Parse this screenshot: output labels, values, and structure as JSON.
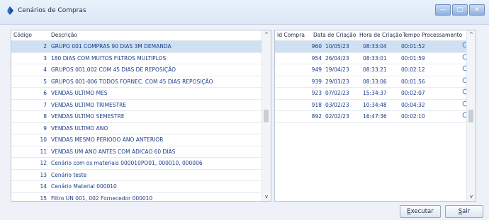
{
  "window": {
    "title": "Cenários de Compras",
    "minimize_glyph": "—",
    "maximize_glyph": "□",
    "close_glyph": "✕"
  },
  "left_table": {
    "headers": {
      "code": "Código",
      "desc": "Descrição"
    },
    "rows": [
      {
        "code": "2",
        "desc": "GRUPO 001 COMPRAS 90 DIAS 3M DEMANDA",
        "selected": true
      },
      {
        "code": "3",
        "desc": "180 DIAS COM MUITOS FILTROS MULTIPLOS"
      },
      {
        "code": "4",
        "desc": "GRUPOS 001,002 COM 45 DIAS DE REPOSIÇÃO"
      },
      {
        "code": "5",
        "desc": "GRUPOS 001-006 TODOS FORNEC. COM 45 DIAS REPOSIÇÃO"
      },
      {
        "code": "6",
        "desc": "VENDAS ULTIMO MES"
      },
      {
        "code": "7",
        "desc": "VENDAS ULTIMO TRIMESTRE"
      },
      {
        "code": "8",
        "desc": "VENDAS ULTIMO SEMESTRE"
      },
      {
        "code": "9",
        "desc": "VENDAS ULTIMO ANO"
      },
      {
        "code": "10",
        "desc": "VENDAS MESMO PERIODO ANO ANTERIOR"
      },
      {
        "code": "11",
        "desc": "VENDAS UM ANO ANTES COM ADICAO 60 DIAS"
      },
      {
        "code": "12",
        "desc": "Cenário com os materiais 000010PO01, 000010, 000006"
      },
      {
        "code": "13",
        "desc": "Cenário teste"
      },
      {
        "code": "14",
        "desc": "Cenário Material 000010"
      },
      {
        "code": "15",
        "desc": "Filtro UN 001, 002 Fornecedor 000010"
      }
    ]
  },
  "right_table": {
    "headers": {
      "id": "Id Compra",
      "date": "Data de Criação",
      "hora": "Hora de Criação",
      "tempo": "Tempo Processamento"
    },
    "rows": [
      {
        "id": "960",
        "date": "10/05/23",
        "hora": "08:33:04",
        "tempo": "00:01:52",
        "selected": true
      },
      {
        "id": "954",
        "date": "26/04/23",
        "hora": "08:33:01",
        "tempo": "00:01:59"
      },
      {
        "id": "949",
        "date": "19/04/23",
        "hora": "08:33:21",
        "tempo": "00:02:12"
      },
      {
        "id": "939",
        "date": "29/03/23",
        "hora": "08:33:06",
        "tempo": "00:01:56"
      },
      {
        "id": "923",
        "date": "07/02/23",
        "hora": "15:34:37",
        "tempo": "00:02:07"
      },
      {
        "id": "918",
        "date": "03/02/23",
        "hora": "10:34:48",
        "tempo": "00:04:32"
      },
      {
        "id": "892",
        "date": "02/02/23",
        "hora": "16:47:36",
        "tempo": "00:02:10"
      }
    ],
    "row_icon": "search-icon"
  },
  "scroll_glyphs": {
    "up": "^",
    "down": "v"
  },
  "buttons": {
    "executar": {
      "accel": "E",
      "rest": "xecutar"
    },
    "sair": {
      "accel": "S",
      "rest": "air"
    }
  }
}
